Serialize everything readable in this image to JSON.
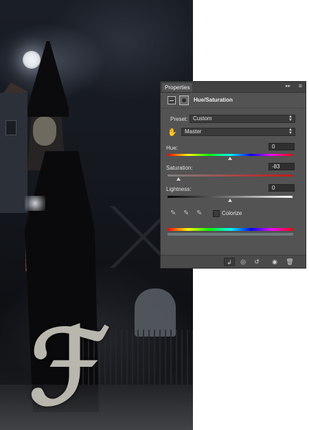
{
  "panel": {
    "tab_label": "Properties",
    "collapse_icon": "double-chevron-right-icon",
    "menu_icon": "panel-menu-icon",
    "adjustment_title": "Hue/Saturation",
    "preset_label": "Preset:",
    "preset_value": "Custom",
    "channel_value": "Master",
    "hue_label": "Hue:",
    "hue_value": "0",
    "saturation_label": "Saturation:",
    "saturation_value": "-83",
    "lightness_label": "Lightness:",
    "lightness_value": "0",
    "colorize_label": "Colorize",
    "colorize_checked": false
  },
  "colors": {
    "panel_bg": "#535353",
    "panel_dark": "#424242",
    "field_bg": "#2f2f2f",
    "text": "#e6e6e6"
  }
}
